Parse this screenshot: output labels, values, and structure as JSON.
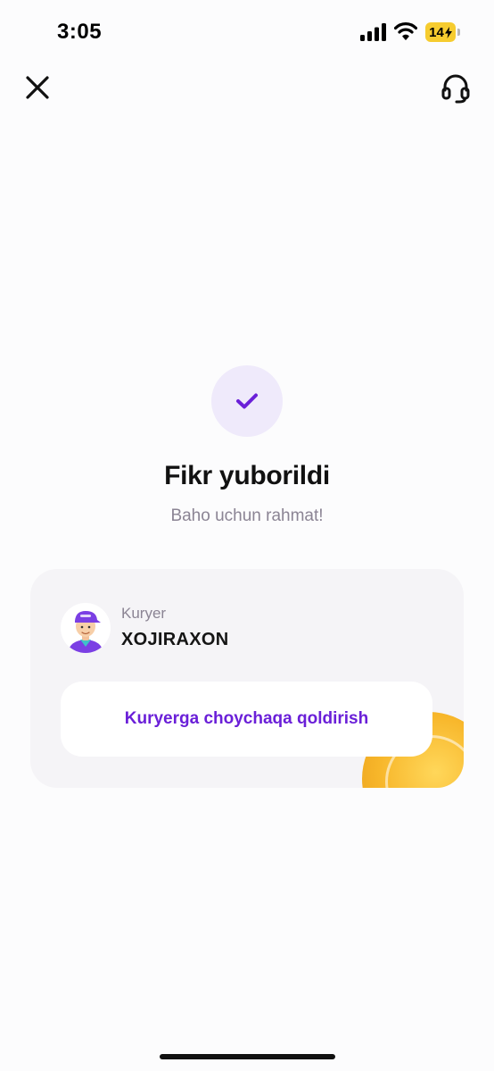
{
  "status_bar": {
    "time": "3:05",
    "battery_level": "14",
    "battery_color": "#f6cc2f"
  },
  "header": {
    "close_icon": "close-icon",
    "support_icon": "headset-icon"
  },
  "confirmation": {
    "icon": "checkmark-icon",
    "title": "Fikr yuborildi",
    "subtitle": "Baho uchun rahmat!"
  },
  "courier": {
    "role_label": "Kuryer",
    "name": "XOJIRAXON",
    "avatar_icon": "courier-avatar-icon",
    "tip_button_label": "Kuryerga choychaqa qoldirish",
    "decoration": "coin-icon"
  },
  "colors": {
    "accent": "#6a1fd8",
    "accent_light": "#efeafb",
    "muted_text": "#8b8494",
    "card_background": "#f5f4f7"
  }
}
